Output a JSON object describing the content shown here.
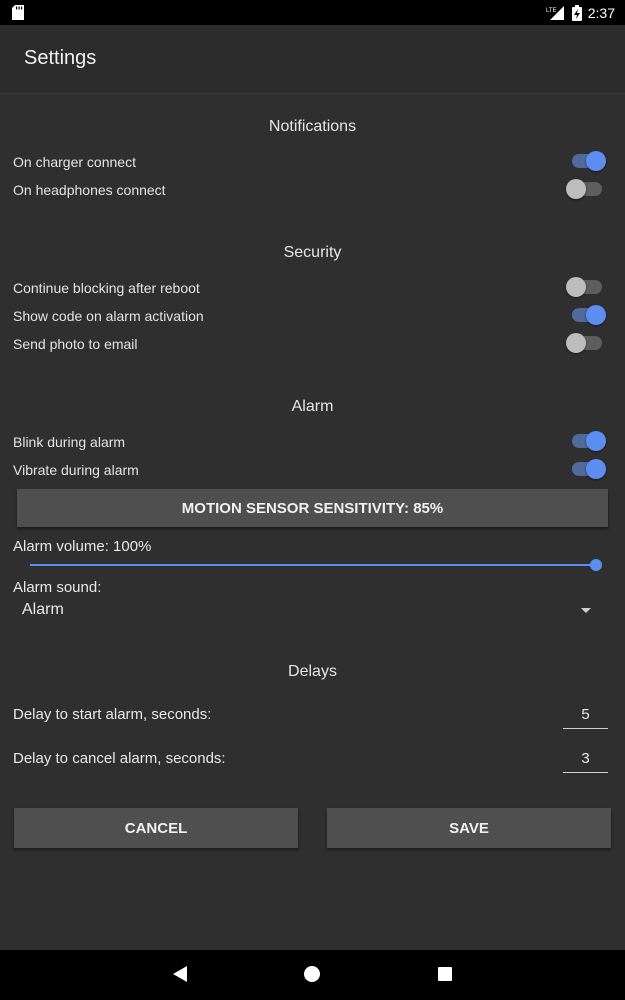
{
  "status_bar": {
    "network": "LTE",
    "time": "2:37"
  },
  "app_bar": {
    "title": "Settings"
  },
  "notifications": {
    "title": "Notifications",
    "items": [
      {
        "label": "On charger connect",
        "on": true
      },
      {
        "label": "On headphones connect",
        "on": false
      }
    ]
  },
  "security": {
    "title": "Security",
    "items": [
      {
        "label": "Continue blocking after reboot",
        "on": false
      },
      {
        "label": "Show code on alarm activation",
        "on": true
      },
      {
        "label": "Send photo to email",
        "on": false
      }
    ]
  },
  "alarm": {
    "title": "Alarm",
    "items": [
      {
        "label": "Blink during alarm",
        "on": true
      },
      {
        "label": "Vibrate during alarm",
        "on": true
      }
    ],
    "sensitivity_button": "MOTION SENSOR SENSITIVITY: 85%",
    "volume_label": "Alarm volume: 100%",
    "volume_value": 1.0,
    "sound_label": "Alarm sound:",
    "sound_value": "Alarm"
  },
  "delays": {
    "title": "Delays",
    "start_label": "Delay to start alarm, seconds:",
    "start_value": "5",
    "cancel_label": "Delay to cancel alarm, seconds:",
    "cancel_value": "3"
  },
  "actions": {
    "cancel": "CANCEL",
    "save": "SAVE"
  },
  "colors": {
    "accent": "#5c8ef2",
    "background": "#2f2f30",
    "button": "#4f4f50"
  },
  "icons": [
    "sd-card-icon",
    "lte-signal-icon",
    "battery-charging-icon",
    "back-icon",
    "home-icon",
    "recents-icon",
    "dropdown-arrow-icon"
  ]
}
